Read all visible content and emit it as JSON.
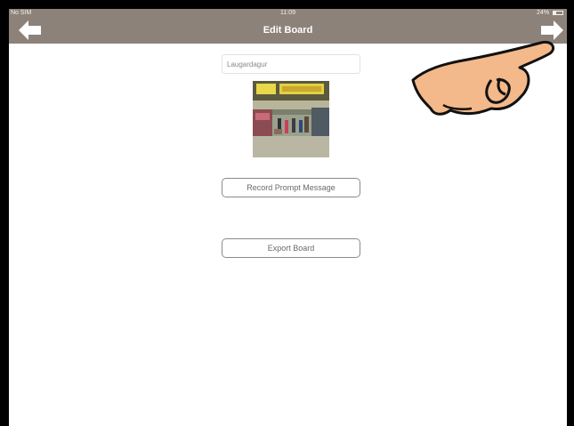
{
  "status_bar": {
    "carrier": "No SIM",
    "time": "11:09",
    "battery": "24%"
  },
  "header": {
    "title": "Edit Board",
    "back_icon": "arrow-left-icon",
    "forward_icon": "arrow-right-icon"
  },
  "board": {
    "name_value": "Laugardagur",
    "image_icon": "supermarket-photo"
  },
  "buttons": {
    "record_prompt": "Record Prompt Message",
    "export_board": "Export Board"
  },
  "colors": {
    "nav_bg": "#8d8279",
    "title_text": "#ffffff",
    "hand_skin": "#f3b98a"
  },
  "overlay": {
    "hand_icon": "pointing-hand-icon"
  }
}
